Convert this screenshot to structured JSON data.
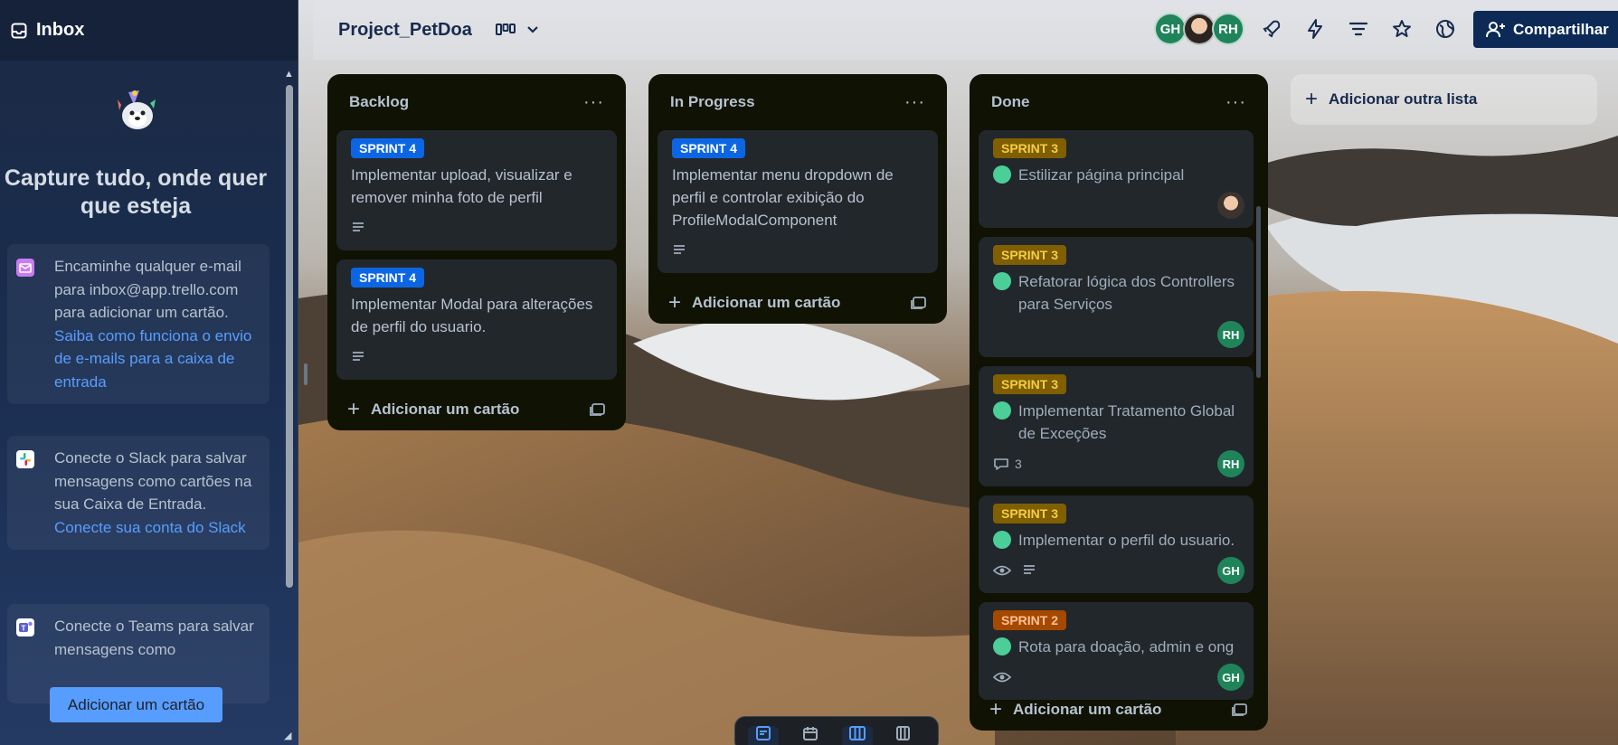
{
  "inbox": {
    "title": "Inbox",
    "heading": "Capture tudo, onde quer que esteja",
    "email_card": {
      "text": "Encaminhe qualquer e-mail para inbox@app.trello.com para adicionar um cartão.",
      "link": "Saiba como funciona o envio de e-mails para a caixa de entrada"
    },
    "slack_card": {
      "text": "Conecte o Slack para salvar mensagens como cartões na sua Caixa de Entrada.",
      "link": "Conecte sua conta do Slack"
    },
    "teams_card": {
      "text": "Conecte o Teams para salvar mensagens como"
    },
    "add_button": "Adicionar um cartão"
  },
  "board": {
    "title": "Project_PetDoa",
    "members": [
      "GH",
      "RH"
    ],
    "share_label": "Compartilhar",
    "add_list_label": "Adicionar outra lista"
  },
  "lists": {
    "backlog": {
      "title": "Backlog",
      "add_card": "Adicionar um cartão",
      "cards": [
        {
          "label": "SPRINT 4",
          "text": "Implementar upload, visualizar e remover minha foto de perfil"
        },
        {
          "label": "SPRINT 4",
          "text": "Implementar Modal para alterações de perfil do usuario."
        }
      ]
    },
    "in_progress": {
      "title": "In Progress",
      "add_card": "Adicionar um cartão",
      "cards": [
        {
          "label": "SPRINT 4",
          "text": "Implementar menu dropdown de perfil e controlar exibição do ProfileModalComponent"
        }
      ]
    },
    "done": {
      "title": "Done",
      "add_card": "Adicionar um cartão",
      "cards": [
        {
          "label": "SPRINT 3",
          "text": "Estilizar página principal"
        },
        {
          "label": "SPRINT 3",
          "text": "Refatorar lógica dos Controllers para Serviços",
          "member": "RH"
        },
        {
          "label": "SPRINT 3",
          "text": "Implementar Tratamento Global de Exceções",
          "comments": "3",
          "member": "RH"
        },
        {
          "label": "SPRINT 3",
          "text": "Implementar o perfil do usuario.",
          "member": "GH"
        },
        {
          "label": "SPRINT 2",
          "text": "Rota para doação, admin e ong",
          "member": "GH"
        }
      ]
    }
  },
  "colors": {
    "label_blue": "#0c66e4",
    "label_yellow": "#7f5f01",
    "label_orange": "#a54800",
    "member_green": "#1f845a",
    "check_green": "#4bce97",
    "share_button": "#0c2a55"
  },
  "icons": [
    "inbox-icon",
    "board-view-icon",
    "chevron-down-icon",
    "rocket-icon",
    "lightning-icon",
    "filter-icon",
    "star-icon",
    "globe-icon",
    "add-person-icon",
    "description-icon",
    "comment-icon",
    "watch-icon",
    "template-icon"
  ]
}
